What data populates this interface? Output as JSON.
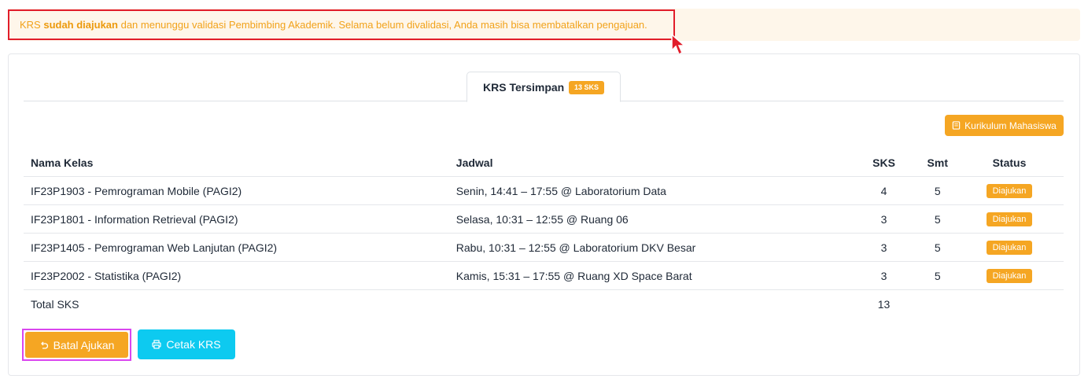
{
  "alert": {
    "prefix": "KRS ",
    "bold": "sudah diajukan",
    "suffix": " dan menunggu validasi Pembimbing Akademik. Selama belum divalidasi, Anda masih bisa membatalkan pengajuan."
  },
  "tab": {
    "label": "KRS Tersimpan",
    "badge": "13 SKS"
  },
  "kurikulum_button": "Kurikulum Mahasiswa",
  "table": {
    "headers": {
      "nama": "Nama Kelas",
      "jadwal": "Jadwal",
      "sks": "SKS",
      "smt": "Smt",
      "status": "Status"
    },
    "rows": [
      {
        "nama": "IF23P1903 - Pemrograman Mobile (PAGI2)",
        "jadwal": "Senin, 14:41 – 17:55 @ Laboratorium Data",
        "sks": "4",
        "smt": "5",
        "status": "Diajukan"
      },
      {
        "nama": "IF23P1801 - Information Retrieval (PAGI2)",
        "jadwal": "Selasa, 10:31 – 12:55 @ Ruang 06",
        "sks": "3",
        "smt": "5",
        "status": "Diajukan"
      },
      {
        "nama": "IF23P1405 - Pemrograman Web Lanjutan (PAGI2)",
        "jadwal": "Rabu, 10:31 – 12:55 @ Laboratorium DKV Besar",
        "sks": "3",
        "smt": "5",
        "status": "Diajukan"
      },
      {
        "nama": "IF23P2002 - Statistika (PAGI2)",
        "jadwal": "Kamis, 15:31 – 17:55 @ Ruang XD Space Barat",
        "sks": "3",
        "smt": "5",
        "status": "Diajukan"
      }
    ],
    "total_label": "Total SKS",
    "total_value": "13"
  },
  "buttons": {
    "batal": "Batal Ajukan",
    "cetak": "Cetak KRS"
  },
  "colors": {
    "warning": "#f5a623",
    "info": "#0dcaf0",
    "highlight_red": "#e11d2a",
    "highlight_magenta": "#d946ef"
  },
  "icons": {
    "kurikulum": "book-icon",
    "batal": "undo-icon",
    "cetak": "printer-icon",
    "cursor": "cursor-icon"
  }
}
